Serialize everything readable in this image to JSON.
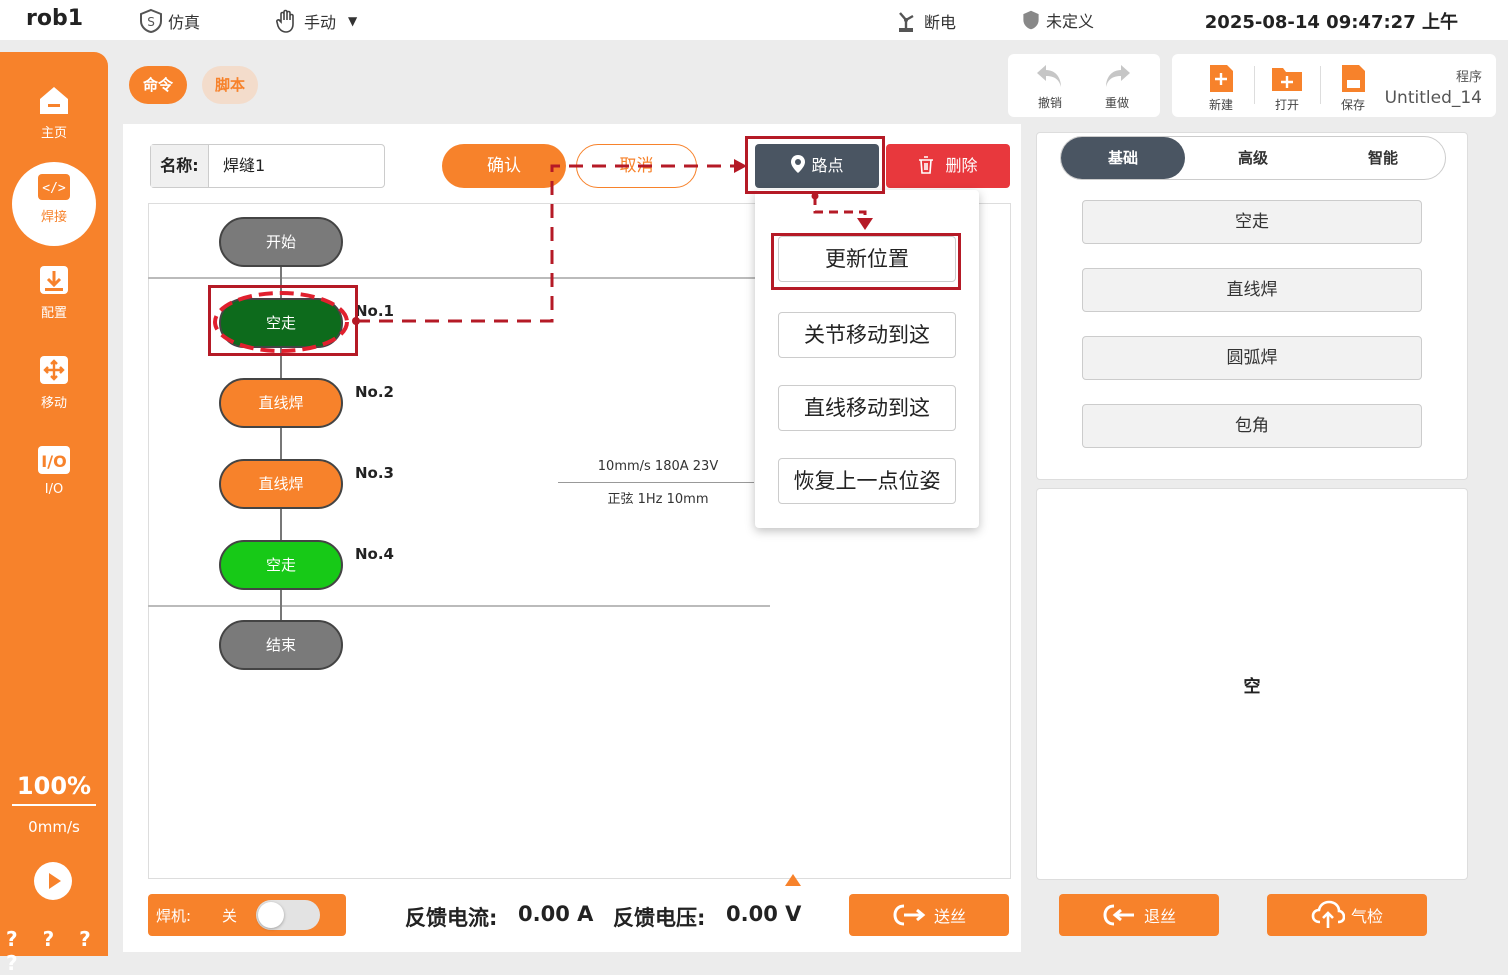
{
  "header": {
    "title": "rob1",
    "sim_label": "仿真",
    "mode_label": "手动",
    "power_label": "断电",
    "safety_label": "未定义",
    "datetime": "2025-08-14 09:47:27 上午"
  },
  "sidebar": {
    "items": [
      {
        "label": "主页",
        "icon": "home-icon"
      },
      {
        "label": "焊接",
        "icon": "code-icon"
      },
      {
        "label": "配置",
        "icon": "download-icon"
      },
      {
        "label": "移动",
        "icon": "move-icon"
      },
      {
        "label": "I/O",
        "icon": "io-icon"
      }
    ],
    "speed_percent": "100%",
    "speed_value": "0mm/s",
    "help_marks": "? ? ? ?"
  },
  "mode_tabs": {
    "command": "命令",
    "script": "脚本"
  },
  "toolbar": {
    "undo": "撤销",
    "redo": "重做",
    "new": "新建",
    "open": "打开",
    "save": "保存",
    "program_label": "程序",
    "program_name": "Untitled_14"
  },
  "editor": {
    "name_label": "名称:",
    "name_value": "焊缝1",
    "confirm": "确认",
    "cancel": "取消",
    "waypoint": "路点",
    "delete": "删除"
  },
  "flow": {
    "start": "开始",
    "end": "结束",
    "steps": [
      {
        "label": "空走",
        "no": "No.1"
      },
      {
        "label": "直线焊",
        "no": "No.2"
      },
      {
        "label": "直线焊",
        "no": "No.3"
      },
      {
        "label": "空走",
        "no": "No.4"
      }
    ],
    "params_line1": "10mm/s 180A 23V",
    "params_line2": "正弦 1Hz 10mm"
  },
  "waypoint_menu": {
    "items": [
      "更新位置",
      "关节移动到这",
      "直线移动到这",
      "恢复上一点位姿"
    ]
  },
  "right_panel": {
    "tabs": [
      "基础",
      "高级",
      "智能"
    ],
    "buttons": [
      "空走",
      "直线焊",
      "圆弧焊",
      "包角"
    ],
    "empty": "空"
  },
  "bottom": {
    "welder_label": "焊机:",
    "welder_state": "关",
    "welder_on": false,
    "current_label": "反馈电流:",
    "current_value": "0.00 A",
    "voltage_label": "反馈电压:",
    "voltage_value": "0.00 V",
    "feed_wire": "送丝",
    "retract_wire": "退丝",
    "gas_check": "气检"
  },
  "colors": {
    "accent": "#f7822b",
    "dark": "#4a5562",
    "danger": "#e8383d",
    "annotation": "#b51a26",
    "step_active": "#0d6b1c",
    "step_idle": "#17c917"
  }
}
